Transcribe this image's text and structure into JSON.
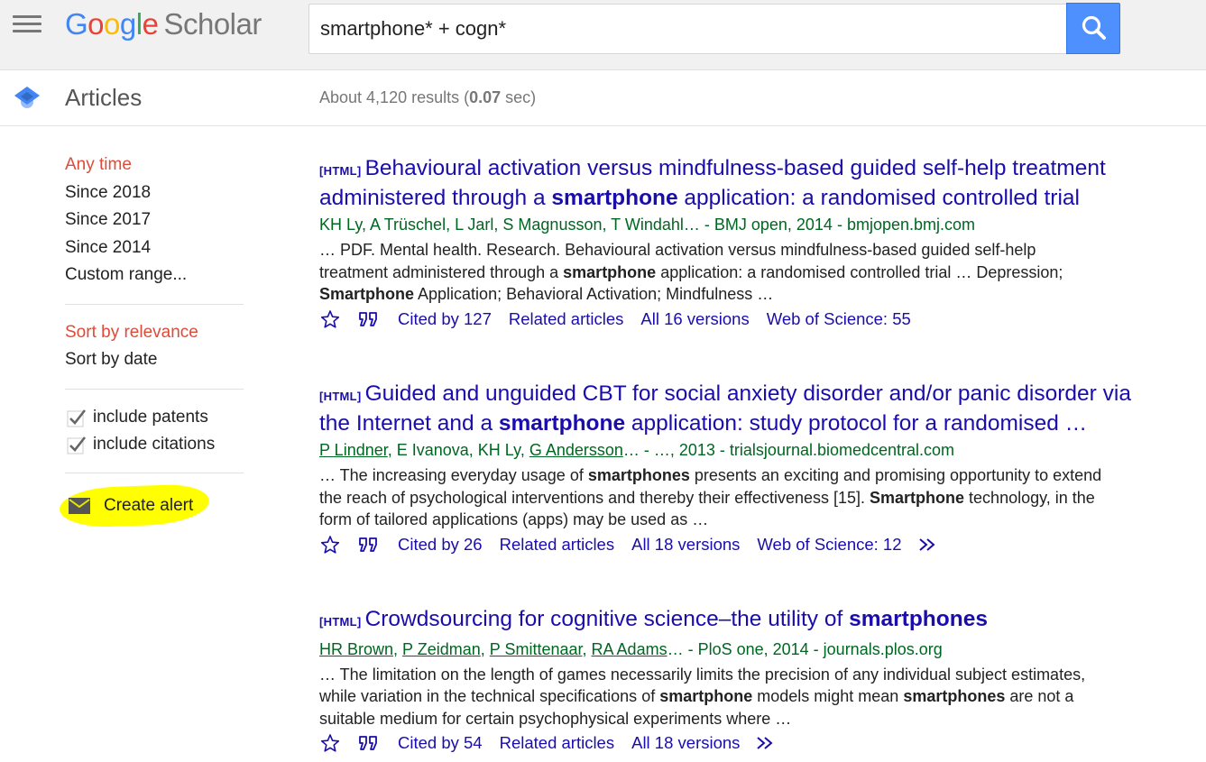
{
  "header": {
    "logo_google": "Google",
    "logo_scholar": "Scholar",
    "search_query": "smartphone* + cogn*"
  },
  "subheader": {
    "articles_label": "Articles",
    "stats_prefix": "About 4,120 results (",
    "stats_time": "0.07",
    "stats_suffix": " sec)"
  },
  "sidebar": {
    "time_items": [
      {
        "label": "Any time",
        "active": true
      },
      {
        "label": "Since 2018",
        "active": false
      },
      {
        "label": "Since 2017",
        "active": false
      },
      {
        "label": "Since 2014",
        "active": false
      },
      {
        "label": "Custom range...",
        "active": false
      }
    ],
    "sort_items": [
      {
        "label": "Sort by relevance",
        "active": true
      },
      {
        "label": "Sort by date",
        "active": false
      }
    ],
    "checkboxes": [
      {
        "label": "include patents",
        "checked": true
      },
      {
        "label": "include citations",
        "checked": true
      }
    ],
    "create_alert": "Create alert"
  },
  "results": [
    {
      "tag": "[HTML]",
      "title": [
        {
          "t": "Behavioural activation versus mindfulness-based guided self-help treatment administered through a ",
          "b": false
        },
        {
          "t": "smartphone",
          "b": true
        },
        {
          "t": " application: a randomised controlled trial",
          "b": false
        }
      ],
      "authors": [
        {
          "t": "KH Ly, A Trüschel, L Jarl, S Magnusson, T Windahl… - BMJ open, 2014 - bmjopen.bmj.com",
          "u": false
        }
      ],
      "snippet": [
        {
          "t": "… PDF. Mental health. Research. Behavioural activation versus mindfulness-based guided self-help treatment administered through a ",
          "b": false
        },
        {
          "t": "smartphone",
          "b": true
        },
        {
          "t": " application: a randomised controlled trial … Depression; ",
          "b": false
        },
        {
          "t": "Smartphone",
          "b": true
        },
        {
          "t": " Application; Behavioral Activation; Mindfulness …",
          "b": false
        }
      ],
      "cited_by": "Cited by 127",
      "related": "Related articles",
      "versions": "All 16 versions",
      "wos": "Web of Science: 55",
      "more": false
    },
    {
      "tag": "[HTML]",
      "title": [
        {
          "t": "Guided and unguided CBT for social anxiety disorder and/or panic disorder via the Internet and a ",
          "b": false
        },
        {
          "t": "smartphone",
          "b": true
        },
        {
          "t": " application: study protocol for a randomised …",
          "b": false
        }
      ],
      "authors": [
        {
          "t": "P Lindner",
          "u": true
        },
        {
          "t": ", E Ivanova, KH Ly, ",
          "u": false
        },
        {
          "t": "G Andersson",
          "u": true
        },
        {
          "t": "… - …, 2013 - trialsjournal.biomedcentral.com",
          "u": false
        }
      ],
      "snippet": [
        {
          "t": "… The increasing everyday usage of ",
          "b": false
        },
        {
          "t": "smartphones",
          "b": true
        },
        {
          "t": " presents an exciting and promising opportunity to extend the reach of psychological interventions and thereby their effectiveness [15]. ",
          "b": false
        },
        {
          "t": "Smartphone",
          "b": true
        },
        {
          "t": " technology, in the form of tailored applications (apps) may be used as …",
          "b": false
        }
      ],
      "cited_by": "Cited by 26",
      "related": "Related articles",
      "versions": "All 18 versions",
      "wos": "Web of Science: 12",
      "more": true
    },
    {
      "tag": "[HTML]",
      "title": [
        {
          "t": "Crowdsourcing for cognitive science–the utility of ",
          "b": false
        },
        {
          "t": "smartphones",
          "b": true
        }
      ],
      "authors": [
        {
          "t": "HR Brown",
          "u": true
        },
        {
          "t": ", ",
          "u": false
        },
        {
          "t": "P Zeidman",
          "u": true
        },
        {
          "t": ", ",
          "u": false
        },
        {
          "t": "P Smittenaar",
          "u": true
        },
        {
          "t": ", ",
          "u": false
        },
        {
          "t": "RA Adams",
          "u": true
        },
        {
          "t": "… - PloS one, 2014 - journals.plos.org",
          "u": false
        }
      ],
      "snippet": [
        {
          "t": "… The limitation on the length of games necessarily limits the precision of any individual subject estimates, while variation in the technical specifications of ",
          "b": false
        },
        {
          "t": "smartphone",
          "b": true
        },
        {
          "t": " models might mean ",
          "b": false
        },
        {
          "t": "smartphones",
          "b": true
        },
        {
          "t": " are not a suitable medium for certain psychophysical experiments where …",
          "b": false
        }
      ],
      "cited_by": "Cited by 54",
      "related": "Related articles",
      "versions": "All 18 versions",
      "wos": "",
      "more": true
    }
  ]
}
